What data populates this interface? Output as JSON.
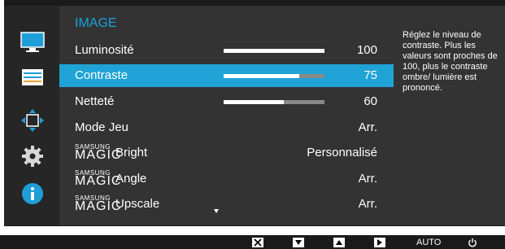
{
  "menu": {
    "title": "IMAGE",
    "items": [
      {
        "label": "Luminosité",
        "value": "100",
        "bar": 1.0
      },
      {
        "label": "Contraste",
        "value": "75",
        "bar": 0.75,
        "selected": true
      },
      {
        "label": "Netteté",
        "value": "60",
        "bar": 0.6
      },
      {
        "label": "Mode Jeu",
        "value": "Arr."
      },
      {
        "label_prefix_small": "SAMSUNG",
        "label_prefix": "MAGIC",
        "label": "Bright",
        "value": "Personnalisé"
      },
      {
        "label_prefix_small": "SAMSUNG",
        "label_prefix": "MAGIC",
        "label": "Angle",
        "value": "Arr."
      },
      {
        "label_prefix_small": "SAMSUNG",
        "label_prefix": "MAGIC",
        "label": "Upscale",
        "value": "Arr."
      }
    ]
  },
  "help": {
    "text": "Réglez le niveau de contraste. Plus les valeurs sont proches de 100, plus le contraste ombre/ lumière est prononcé."
  },
  "sidebar": {
    "icons": [
      "monitor-icon",
      "picture-settings-icon",
      "move-arrows-icon",
      "gear-icon",
      "info-icon"
    ],
    "accent": "#1e9fd8"
  },
  "bottom_bar": {
    "auto_label": "AUTO",
    "buttons": [
      "close-icon",
      "down-arrow-icon",
      "up-arrow-icon",
      "right-arrow-icon",
      "auto",
      "power-icon"
    ]
  },
  "colors": {
    "selection": "#20a3d6",
    "title": "#19a3dc",
    "menu_bg": "#333333"
  }
}
